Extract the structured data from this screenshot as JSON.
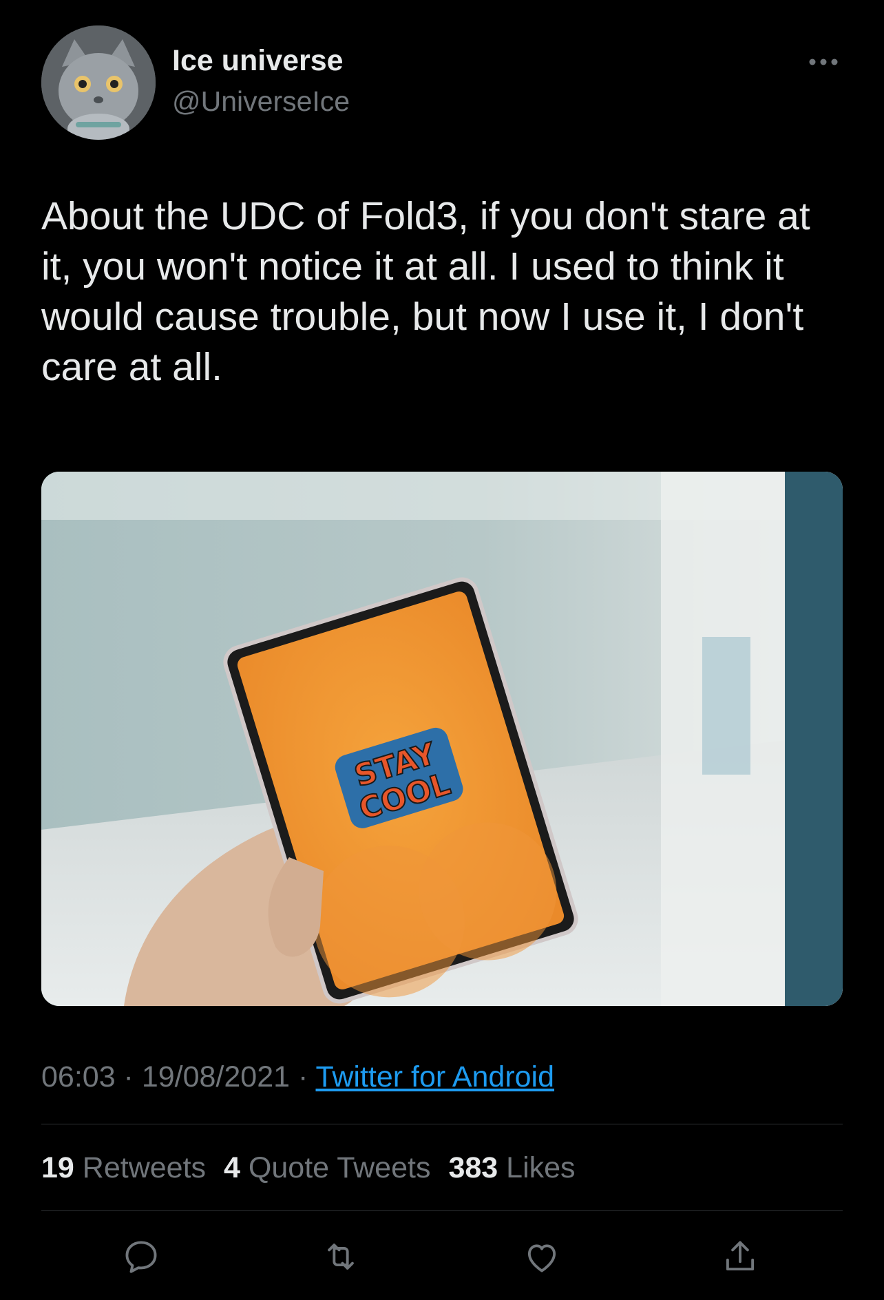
{
  "author": {
    "display_name": "Ice universe",
    "handle": "@UniverseIce",
    "avatar_icon": "cat-avatar"
  },
  "tweet": {
    "text": "About the UDC of Fold3, if you don't stare at it, you won't notice it at all. I used to think it would cause trouble, but now I use it, I don't care at all.",
    "media": {
      "screen_text_line1": "STAY",
      "screen_text_line2": "COOL"
    },
    "time": "06:03",
    "separator": " · ",
    "date": "19/08/2021",
    "source": "Twitter for Android"
  },
  "stats": {
    "retweets_count": "19",
    "retweets_label": "Retweets",
    "quotes_count": "4",
    "quotes_label": "Quote Tweets",
    "likes_count": "383",
    "likes_label": "Likes"
  },
  "actions": [
    "reply-icon",
    "retweet-icon",
    "like-icon",
    "share-icon"
  ],
  "colors": {
    "background": "#000000",
    "text_primary": "#e7e9ea",
    "text_secondary": "#71767b",
    "link": "#1d9bf0",
    "divider": "#2f3336"
  }
}
